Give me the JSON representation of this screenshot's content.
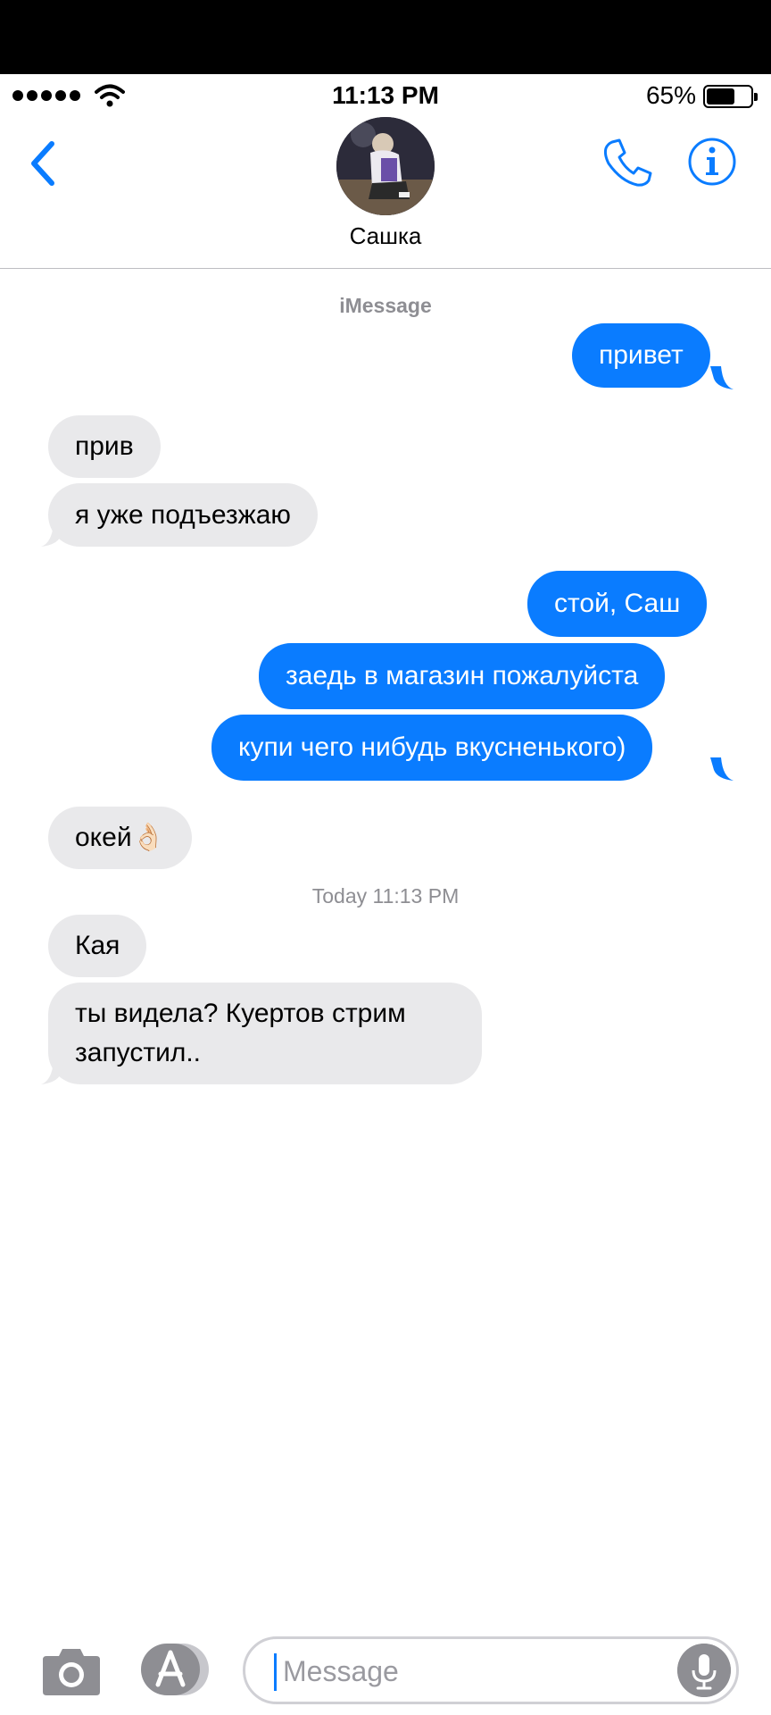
{
  "status_bar": {
    "time": "11:13 PM",
    "battery_percent": "65%",
    "battery_level": 0.65,
    "signal_bars": 5
  },
  "header": {
    "contact_name": "Сашка",
    "back_icon": "chevron-left-icon",
    "call_icon": "phone-icon",
    "info_icon": "info-icon"
  },
  "conversation": {
    "service_label": "iMessage",
    "timestamp": {
      "day": "Today",
      "time": "11:13 PM"
    },
    "messages": [
      {
        "from": "me",
        "text": "привет"
      },
      {
        "from": "contact",
        "text": "прив"
      },
      {
        "from": "contact",
        "text": "я уже подъезжаю"
      },
      {
        "from": "me",
        "text": "стой, Саш"
      },
      {
        "from": "me",
        "text": "заедь в магазин пожалуйста"
      },
      {
        "from": "me",
        "text": "купи чего нибудь вкусненького)"
      },
      {
        "from": "contact",
        "text": "окей👌🏻"
      },
      {
        "from": "contact",
        "text": "Кая"
      },
      {
        "from": "contact",
        "text_line1": "ты видела? Куертов стрим",
        "text_line2": "запустил.."
      }
    ]
  },
  "input_bar": {
    "placeholder": "Message",
    "camera_icon": "camera-icon",
    "apps_icon": "app-store-icon",
    "mic_icon": "microphone-icon"
  },
  "colors": {
    "accent": "#0a7cff",
    "incoming_bubble": "#e9e9eb",
    "secondary_text": "#8e8e93"
  }
}
